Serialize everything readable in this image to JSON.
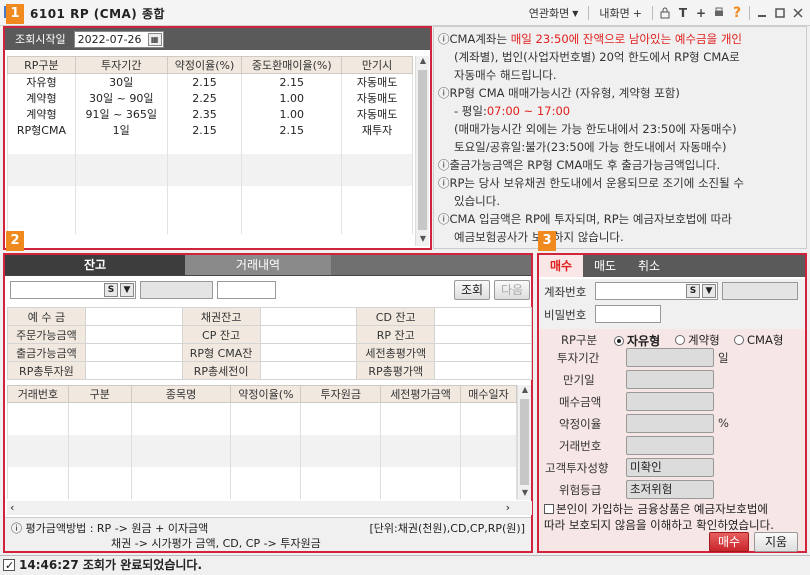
{
  "window": {
    "title": "6101 RP (CMA) 종합",
    "menu_link": "연관화면",
    "menu_inner": "내화면",
    "icons": [
      "lock-icon",
      "text-icon",
      "plus-icon",
      "print-icon",
      "help-icon",
      "minimize-icon",
      "maximize-icon",
      "close-icon"
    ]
  },
  "badges": {
    "p1": "1",
    "p2": "2",
    "p3": "3"
  },
  "panel1": {
    "label_start": "조회시작일",
    "start_date": "2022-07-26",
    "columns": [
      "RP구분",
      "투자기간",
      "약정이율(%)",
      "중도환매이율(%)",
      "만기시"
    ],
    "rows": [
      [
        "자유형",
        "30일",
        "2.15",
        "2.15",
        "자동매도"
      ],
      [
        "계약형",
        "30일 ~ 90일",
        "2.25",
        "1.00",
        "자동매도"
      ],
      [
        "계약형",
        "91일 ~ 365일",
        "2.35",
        "1.00",
        "자동매도"
      ],
      [
        "RP형CMA",
        "1일",
        "2.15",
        "2.15",
        "재투자"
      ]
    ]
  },
  "info": {
    "l1a": "ⓘCMA계좌는 ",
    "l1b": "매일 23:50에 잔액으로 남아있는 예수금을 개인",
    "l2": "(계좌별), 법인(사업자번호별) 20억 한도에서 RP형  CMA로",
    "l3": "자동매수 해드립니다.",
    "l4": "ⓘRP형 CMA 매매가능시간 (자유형, 계약형 포함)",
    "l5a": "- 평일:",
    "l5b": "07:00 ~ 17:00",
    "l6": "(매매가능시간 외에는 가능 한도내에서 23:50에 자동매수)",
    "l7": "토요일/공휴일:불가(23:50에 가능 한도내에서 자동매수)",
    "l8": "ⓘ출금가능금액은 RP형 CMA매도 후 출금가능금액입니다.",
    "l9": "ⓘRP는 당사 보유채권 한도내에서 운용되므로 조기에 소진될 수",
    "l10": "있습니다.",
    "l11": "ⓘCMA 입금액은 RP에 투자되며, RP는 예금자보호법에 따라",
    "l12": "예금보험공사가 보호하지 않습니다."
  },
  "panel2": {
    "tabs": [
      "잔고",
      "거래내역"
    ],
    "s_label": "S",
    "btn_query": "조회",
    "btn_next": "다음",
    "kv": [
      [
        "예 수 금",
        "채권잔고",
        "CD 잔고"
      ],
      [
        "주문가능금액",
        "CP 잔고",
        "RP 잔고"
      ],
      [
        "출금가능금액",
        "RP형 CMA잔",
        "세전총평가액"
      ],
      [
        "RP총투자원",
        "RP총세전이",
        "RP총평가액"
      ]
    ],
    "columns": [
      "거래번호",
      "구분",
      "종목명",
      "약정이율(%",
      "투자원금",
      "세전평가금액",
      "매수일자"
    ],
    "foot_l1": "ⓘ 평가금액방법 : RP   -> 원금 + 이자금액",
    "foot_unit": "[단위:채권(천원),CD,CP,RP(원)]",
    "foot_l2": "채권 -> 시가평가 금액,   CD, CP -> 투자원금"
  },
  "panel3": {
    "tabs": [
      "매수",
      "매도",
      "취소"
    ],
    "acct_label": "계좌번호",
    "pw_label": "비밀번호",
    "s_label": "S",
    "rp_type_label": "RP구분",
    "rp_types": [
      "자유형",
      "계약형",
      "CMA형"
    ],
    "period_label": "투자기간",
    "period_unit": "일",
    "maturity_label": "만기일",
    "amount_label": "매수금액",
    "rate_label": "약정이율",
    "rate_unit": "%",
    "trade_no_label": "거래번호",
    "profile_label": "고객투자성향",
    "profile_value": "미확인",
    "risk_label": "위험등급",
    "risk_value": "초저위험",
    "confirm_l1": "본인이 가입하는 금융상품은 예금자보호법에",
    "confirm_l2": "따라 보호되지 않음을 이해하고 확인하였습니다.",
    "btn_buy": "매수",
    "btn_clear": "지움"
  },
  "status": {
    "time": "14:46:27",
    "message": "조회가 완료되었습니다."
  },
  "colors": {
    "accent": "#d2233c",
    "badge": "#f08a1e",
    "header": "#5a5a5a"
  }
}
